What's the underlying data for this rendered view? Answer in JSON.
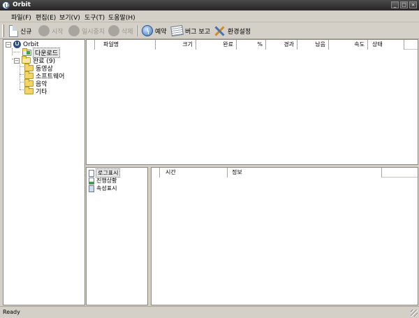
{
  "window": {
    "title": "Orbit"
  },
  "menu": [
    "파일(F)",
    "편집(E)",
    "보기(V)",
    "도구(T)",
    "도움말(H)"
  ],
  "toolbar": {
    "new": "신규",
    "start": "시작",
    "pause": "일시중지",
    "delete": "삭제",
    "schedule": "예약",
    "bug_report": "버그 보고",
    "settings": "환경설정"
  },
  "tree": {
    "root": "Orbit",
    "downloading": "다운로드",
    "completed": "완료 (9)",
    "children": [
      "동영상",
      "소프트웨어",
      "음악",
      "기타"
    ]
  },
  "download_columns": [
    "파일명",
    "크기",
    "완료",
    "%",
    "경과",
    "남음",
    "속도",
    "상태"
  ],
  "side_panel": [
    "로그표시",
    "진행상황",
    "속성표시"
  ],
  "log_columns": [
    "시간",
    "정보"
  ],
  "status": {
    "text": "Ready"
  },
  "colors": {
    "title_bar": "#262626",
    "chrome": "#d4d0c8",
    "panel": "#ffffff"
  }
}
